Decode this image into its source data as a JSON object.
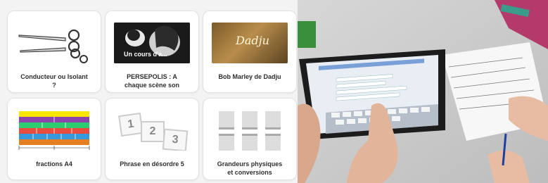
{
  "gallery": {
    "cards": [
      {
        "title": "Conducteur ou Isolant\n?",
        "thumb_icon": "scissors-icon"
      },
      {
        "title": "PERSEPOLIS : A\nchaque scène son",
        "thumb_icon": "persepolis-still",
        "thumb_caption": "Un cours d'a..."
      },
      {
        "title": "Bob Marley de Dadju",
        "thumb_icon": "music-video-still",
        "thumb_caption": "Dadju"
      },
      {
        "title": "fractions A4",
        "thumb_icon": "fraction-bars-icon"
      },
      {
        "title": "Phrase en désordre 5",
        "thumb_icon": "numbered-cards-icon",
        "thumb_numbers": [
          "1",
          "2",
          "3"
        ]
      },
      {
        "title": "Grandeurs physiques\net conversions",
        "thumb_icon": "grid-placeholder-icon"
      }
    ]
  },
  "photo": {
    "description_icon": "classroom-tablet-photo"
  }
}
